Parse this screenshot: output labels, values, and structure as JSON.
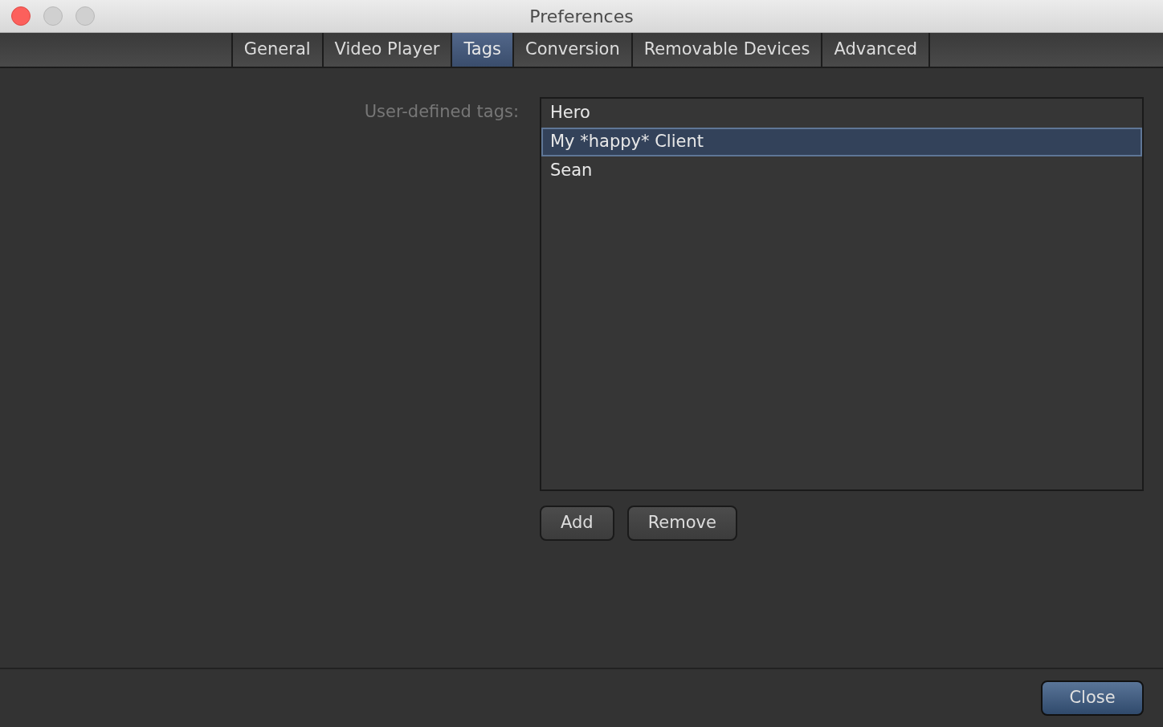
{
  "window": {
    "title": "Preferences"
  },
  "tabs": [
    {
      "label": "General",
      "selected": false
    },
    {
      "label": "Video Player",
      "selected": false
    },
    {
      "label": "Tags",
      "selected": true
    },
    {
      "label": "Conversion",
      "selected": false
    },
    {
      "label": "Removable Devices",
      "selected": false
    },
    {
      "label": "Advanced",
      "selected": false
    }
  ],
  "tags": {
    "label": "User-defined tags:",
    "items": [
      {
        "label": "Hero",
        "selected": false
      },
      {
        "label": "My *happy* Client",
        "selected": true
      },
      {
        "label": "Sean",
        "selected": false
      }
    ],
    "buttons": [
      "Add",
      "Remove"
    ]
  },
  "footer": {
    "close_button": "Close"
  }
}
